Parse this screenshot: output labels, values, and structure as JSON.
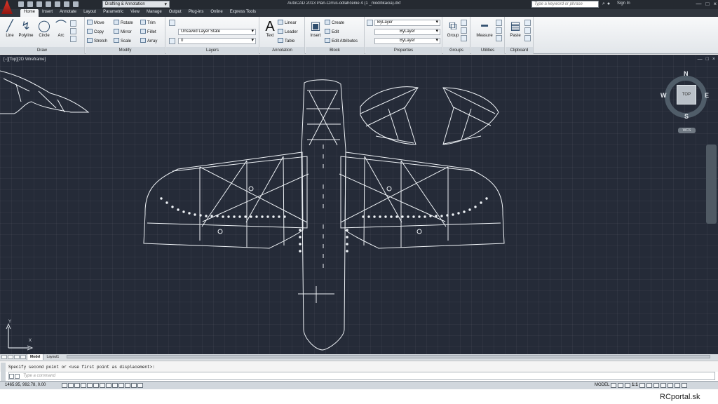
{
  "window": {
    "title": "AutoCAD 2013   Plan-Cirrus-odlahčenie 4 (1 _modifikacia).dxf",
    "workspace": "Drafting & Annotation",
    "search_placeholder": "Type a keyword or phrase",
    "signin": "Sign In"
  },
  "ribbon": {
    "tabs": [
      {
        "label": "Home",
        "active": true
      },
      {
        "label": "Insert"
      },
      {
        "label": "Annotate"
      },
      {
        "label": "Layout"
      },
      {
        "label": "Parametric"
      },
      {
        "label": "View"
      },
      {
        "label": "Manage"
      },
      {
        "label": "Output"
      },
      {
        "label": "Plug-ins"
      },
      {
        "label": "Online"
      },
      {
        "label": "Express Tools"
      }
    ],
    "draw": {
      "title": "Draw",
      "line": "Line",
      "polyline": "Polyline",
      "circle": "Circle",
      "arc": "Arc"
    },
    "modify": {
      "title": "Modify",
      "move": "Move",
      "rotate": "Rotate",
      "trim": "Trim",
      "copy": "Copy",
      "mirror": "Mirror",
      "fillet": "Fillet",
      "stretch": "Stretch",
      "scale": "Scale",
      "array": "Array"
    },
    "layers": {
      "title": "Layers",
      "state": "Unsaved Layer State",
      "current": "0"
    },
    "annotation": {
      "title": "Annotation",
      "text": "Text",
      "linear": "Linear",
      "leader": "Leader",
      "table": "Table"
    },
    "block": {
      "title": "Block",
      "insert": "Insert",
      "create": "Create",
      "edit": "Edit",
      "edit_attributes": "Edit Attributes"
    },
    "properties": {
      "title": "Properties",
      "color": "ByLayer",
      "linetype": "ByLayer",
      "lineweight": "ByLayer"
    },
    "groups": {
      "title": "Groups",
      "group": "Group"
    },
    "utilities": {
      "title": "Utilities",
      "measure": "Measure"
    },
    "clipboard": {
      "title": "Clipboard",
      "paste": "Paste"
    }
  },
  "canvas": {
    "viewport_label": "[−][Top][2D Wireframe]",
    "viewcube": {
      "north": "N",
      "west": "W",
      "east": "E",
      "south": "S",
      "face": "TOP",
      "wcs": "WCS"
    },
    "ucs": {
      "x": "X",
      "y": "Y"
    }
  },
  "layout_tabs": [
    {
      "label": "Model",
      "active": true
    },
    {
      "label": "Layout1"
    }
  ],
  "command": {
    "history": "Specify second point or <use first point as displacement>:",
    "placeholder": "Type a command"
  },
  "status": {
    "coordinates": "1465.95, 992.78, 0.00",
    "space": "MODEL",
    "scale": "1:1"
  },
  "watermark": "RCportal.sk",
  "colors": {
    "canvas": "#252b38",
    "lines": "#eef2f6",
    "autocad_red": "#e23a2c"
  }
}
